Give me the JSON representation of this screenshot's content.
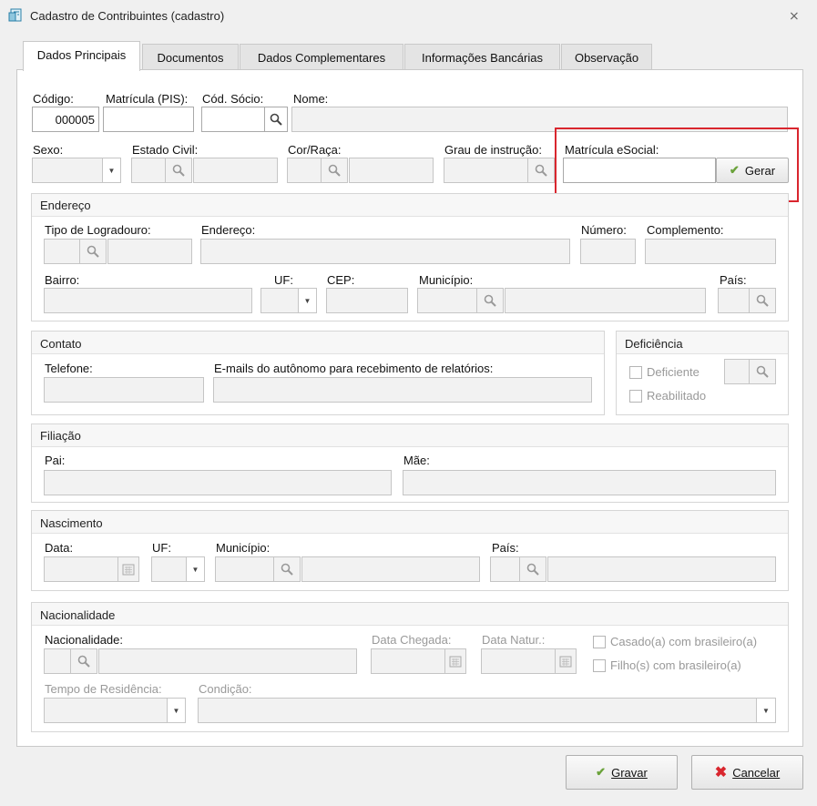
{
  "window": {
    "title": "Cadastro de Contribuintes (cadastro)"
  },
  "tabs": [
    "Dados Principais",
    "Documentos",
    "Dados Complementares",
    "Informações Bancárias",
    "Observação"
  ],
  "main": {
    "codigo_label": "Código:",
    "codigo_value": "000005",
    "matricula_pis_label": "Matrícula (PIS):",
    "cod_socio_label": "Cód. Sócio:",
    "nome_label": "Nome:",
    "sexo_label": "Sexo:",
    "estado_civil_label": "Estado Civil:",
    "cor_raca_label": "Cor/Raça:",
    "grau_instrucao_label": "Grau de instrução:",
    "matricula_esocial_label": "Matrícula eSocial:",
    "gerar_label": "Gerar"
  },
  "endereco": {
    "title": "Endereço",
    "tipo_logradouro_label": "Tipo de Logradouro:",
    "endereco_label": "Endereço:",
    "numero_label": "Número:",
    "complemento_label": "Complemento:",
    "bairro_label": "Bairro:",
    "uf_label": "UF:",
    "cep_label": "CEP:",
    "municipio_label": "Município:",
    "pais_label": "País:"
  },
  "contato": {
    "title": "Contato",
    "telefone_label": "Telefone:",
    "emails_label": "E-mails do autônomo para recebimento de relatórios:"
  },
  "deficiencia": {
    "title": "Deficiência",
    "deficiente_label": "Deficiente",
    "reabilitado_label": "Reabilitado"
  },
  "filiacao": {
    "title": "Filiação",
    "pai_label": "Pai:",
    "mae_label": "Mãe:"
  },
  "nascimento": {
    "title": "Nascimento",
    "data_label": "Data:",
    "uf_label": "UF:",
    "municipio_label": "Município:",
    "pais_label": "País:"
  },
  "nacionalidade": {
    "title": "Nacionalidade",
    "nacionalidade_label": "Nacionalidade:",
    "data_chegada_label": "Data Chegada:",
    "data_natur_label": "Data Natur.:",
    "casado_label": "Casado(a) com brasileiro(a)",
    "filhos_label": "Filho(s) com brasileiro(a)",
    "tempo_residencia_label": "Tempo de Residência:",
    "condicao_label": "Condição:"
  },
  "footer": {
    "gravar_label": "Gravar",
    "cancelar_label": "Cancelar"
  },
  "colors": {
    "highlight": "#d9262e",
    "check": "#6aa23a",
    "cancel": "#d9262e"
  }
}
